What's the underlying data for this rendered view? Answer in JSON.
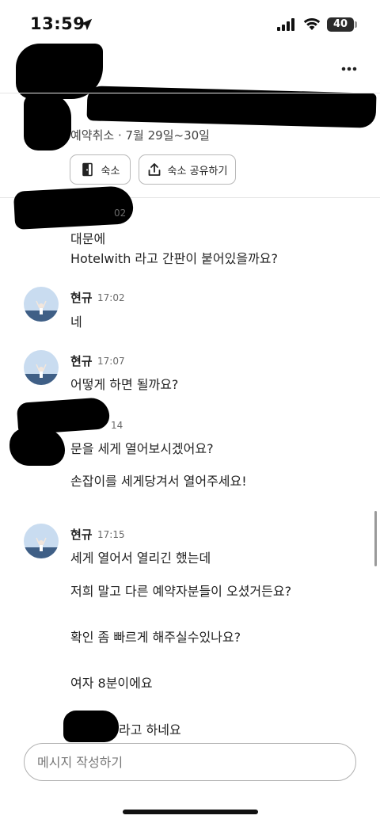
{
  "status_bar": {
    "time": "13:59",
    "battery": "40"
  },
  "header": {
    "more_icon": "more-horizontal-icon"
  },
  "booking": {
    "info": "예약취소 · 7월 29일~30일",
    "stay_label": "숙소",
    "share_label": "숙소 공유하기",
    "stay_icon": "door-icon",
    "share_icon": "share-icon"
  },
  "messages": [
    {
      "lines": [
        "대문에",
        "Hotelwith 라고 간판이 붙어있을까요?"
      ],
      "time_partial": "02"
    },
    {
      "sender": "현규",
      "time": "17:02",
      "lines": [
        "네"
      ]
    },
    {
      "sender": "현규",
      "time": "17:07",
      "lines": [
        "어떻게 하면 될까요?"
      ]
    },
    {
      "time_partial": "14",
      "lines": [
        "문을 세게 열어보시겠어요?",
        "손잡이를 세게당겨서 열어주세요!"
      ]
    },
    {
      "sender": "현규",
      "time": "17:15",
      "lines": [
        "세게 열어서 열리긴 했는데",
        "저희 말고 다른 예약자분들이 오셨거든요?",
        "확인 좀 빠르게 해주실수있나요?",
        "여자 8분이에요",
        "라고 하네요"
      ]
    }
  ],
  "composer": {
    "placeholder": "메시지 작성하기"
  },
  "colors": {
    "redaction": "#000000",
    "text": "#222222",
    "muted": "#6a6a6a",
    "border": "#b0b0b0"
  }
}
